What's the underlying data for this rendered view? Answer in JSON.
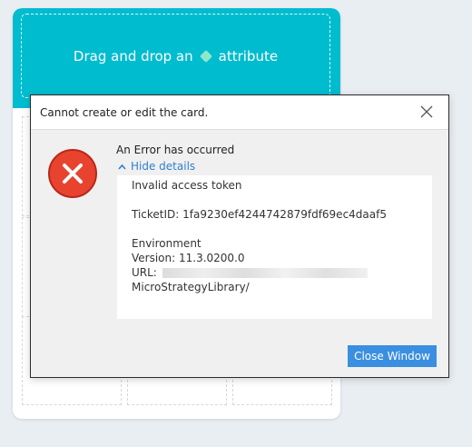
{
  "card": {
    "drop_prefix": "Drag and drop an",
    "drop_suffix": "attribute",
    "drop_icon": "diamond-attribute-icon",
    "accent_color": "#00bccf"
  },
  "dialog": {
    "title": "Cannot create or edit the card.",
    "close_icon": "close-icon",
    "error_icon": "error-x-icon",
    "heading": "An Error has occurred",
    "toggle_label": "Hide details",
    "details": {
      "message": "Invalid access token",
      "ticket": "TicketID: 1fa9230ef4244742879fdf69ec4daaf5",
      "environment": "Environment",
      "version": "Version: 11.3.0200.0",
      "url_label": "URL:",
      "url_suffix": "MicroStrategyLibrary/"
    },
    "close_button": "Close Window",
    "button_color": "#3b8fe0",
    "error_color": "#e8432e"
  }
}
